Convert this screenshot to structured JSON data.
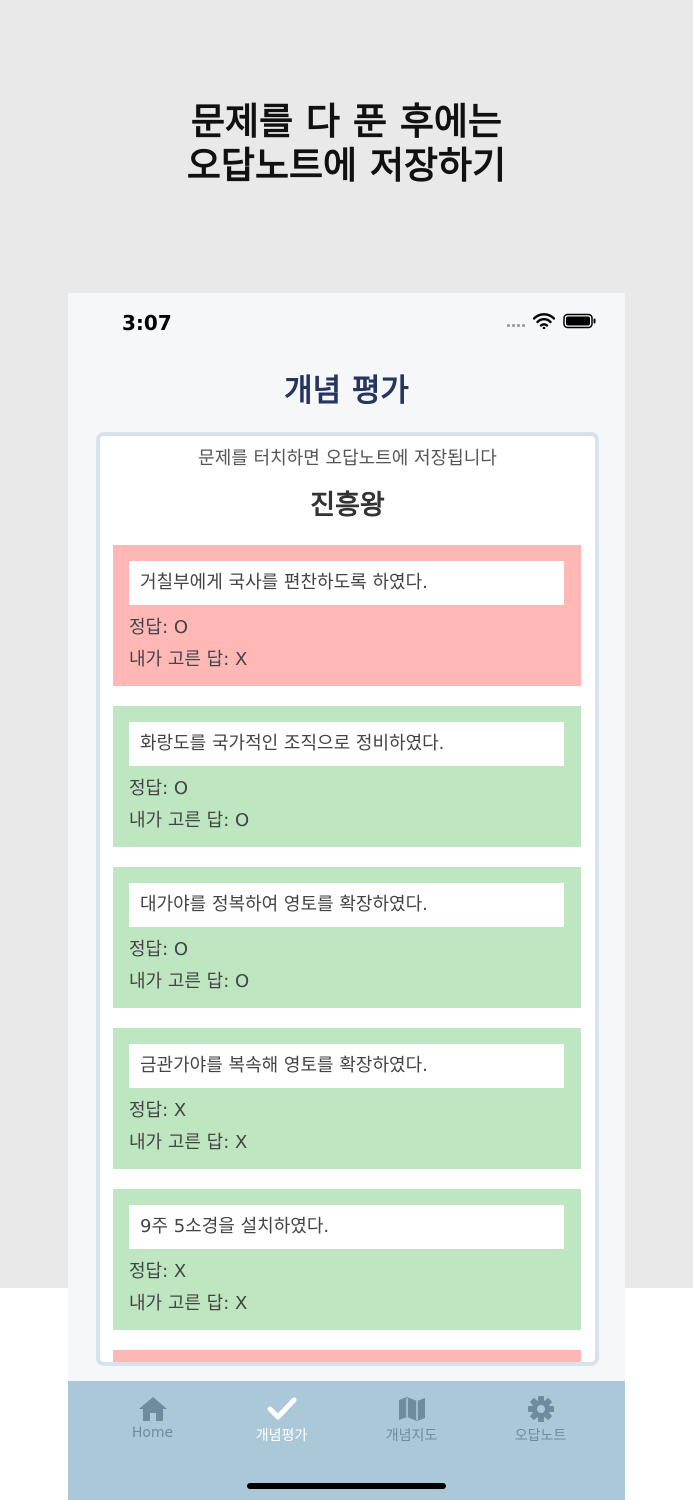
{
  "promo": {
    "line1": "문제를 다 푼 후에는",
    "line2": "오답노트에 저장하기"
  },
  "status": {
    "time": "3:07"
  },
  "header": {
    "title": "개념 평가"
  },
  "card": {
    "hint": "문제를 터치하면 오답노트에 저장됩니다",
    "king": "진흥왕",
    "questions": [
      {
        "text": "거칠부에게 국사를 편찬하도록 하였다.",
        "answer": "정답: O",
        "mine": "내가 고른 답: X",
        "status": "wrong"
      },
      {
        "text": "화랑도를 국가적인 조직으로 정비하였다.",
        "answer": "정답: O",
        "mine": "내가 고른 답: O",
        "status": "correct"
      },
      {
        "text": "대가야를 정복하여 영토를 확장하였다.",
        "answer": "정답: O",
        "mine": "내가 고른 답: O",
        "status": "correct"
      },
      {
        "text": "금관가야를 복속해 영토를 확장하였다.",
        "answer": "정답: X",
        "mine": "내가 고른 답: X",
        "status": "correct"
      },
      {
        "text": "9주 5소경을 설치하였다.",
        "answer": "정답: X",
        "mine": "내가 고른 답: X",
        "status": "correct"
      }
    ]
  },
  "tabbar": {
    "tabs": [
      {
        "label": "Home",
        "icon": "home-icon"
      },
      {
        "label": "개념평가",
        "icon": "checkmark-icon",
        "active": true
      },
      {
        "label": "개념지도",
        "icon": "map-icon"
      },
      {
        "label": "오답노트",
        "icon": "gear-icon"
      }
    ]
  },
  "colors": {
    "wrong": "#ffb8b5",
    "correct": "#bee6c0",
    "accent": "#24355e",
    "tabbar": "#abc8d8"
  }
}
